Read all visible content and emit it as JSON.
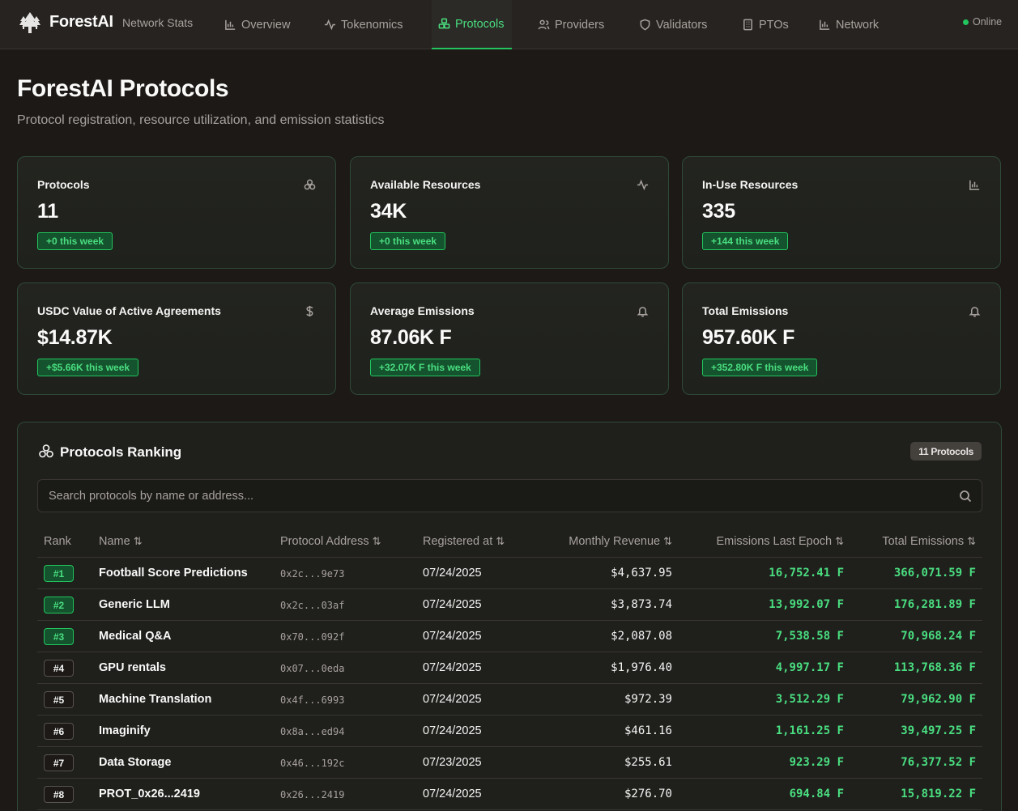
{
  "header": {
    "brand": "ForestAI",
    "brand_sub": "Network Stats",
    "nav": [
      {
        "label": "Overview",
        "icon": "bar-chart-icon"
      },
      {
        "label": "Tokenomics",
        "icon": "activity-icon"
      },
      {
        "label": "Protocols",
        "icon": "boxes-icon",
        "active": true
      },
      {
        "label": "Providers",
        "icon": "users-icon"
      },
      {
        "label": "Validators",
        "icon": "shield-icon"
      },
      {
        "label": "PTOs",
        "icon": "building-icon"
      },
      {
        "label": "Network",
        "icon": "bar-chart-icon"
      }
    ],
    "status": "Online",
    "status_color": "#22c55e"
  },
  "page": {
    "title": "ForestAI Protocols",
    "subtitle": "Protocol registration, resource utilization, and emission statistics"
  },
  "cards": [
    {
      "label": "Protocols",
      "value": "11",
      "delta": "+0 this week",
      "icon": "boxes-icon"
    },
    {
      "label": "Available Resources",
      "value": "34K",
      "delta": "+0 this week",
      "icon": "activity-icon"
    },
    {
      "label": "In-Use Resources",
      "value": "335",
      "delta": "+144 this week",
      "icon": "bar-chart-icon"
    },
    {
      "label": "USDC Value of Active Agreements",
      "value": "$14.87K",
      "delta": "+$5.66K this week",
      "icon": "dollar-icon"
    },
    {
      "label": "Average Emissions",
      "value": "87.06K F",
      "delta": "+32.07K F this week",
      "icon": "bell-icon"
    },
    {
      "label": "Total Emissions",
      "value": "957.60K F",
      "delta": "+352.80K F this week",
      "icon": "bell-icon"
    }
  ],
  "ranking": {
    "title": "Protocols Ranking",
    "badge": "11 Protocols",
    "search_placeholder": "Search protocols by name or address...",
    "columns": [
      "Rank",
      "Name",
      "Protocol Address",
      "Registered at",
      "Monthly Revenue",
      "Emissions Last Epoch",
      "Total Emissions"
    ],
    "sort_glyph": "⇅",
    "rows": [
      {
        "rank": "#1",
        "name": "Football Score Predictions",
        "address": "0x2c...9e73",
        "registered": "07/24/2025",
        "revenue": "$4,637.95",
        "emissions_last": "16,752.41 F",
        "total": "366,071.59 F"
      },
      {
        "rank": "#2",
        "name": "Generic LLM",
        "address": "0x2c...03af",
        "registered": "07/24/2025",
        "revenue": "$3,873.74",
        "emissions_last": "13,992.07 F",
        "total": "176,281.89 F"
      },
      {
        "rank": "#3",
        "name": "Medical Q&A",
        "address": "0x70...092f",
        "registered": "07/24/2025",
        "revenue": "$2,087.08",
        "emissions_last": "7,538.58 F",
        "total": "70,968.24 F"
      },
      {
        "rank": "#4",
        "name": "GPU rentals",
        "address": "0x07...0eda",
        "registered": "07/24/2025",
        "revenue": "$1,976.40",
        "emissions_last": "4,997.17 F",
        "total": "113,768.36 F"
      },
      {
        "rank": "#5",
        "name": "Machine Translation",
        "address": "0x4f...6993",
        "registered": "07/24/2025",
        "revenue": "$972.39",
        "emissions_last": "3,512.29 F",
        "total": "79,962.90 F"
      },
      {
        "rank": "#6",
        "name": "Imaginify",
        "address": "0x8a...ed94",
        "registered": "07/24/2025",
        "revenue": "$461.16",
        "emissions_last": "1,161.25 F",
        "total": "39,497.25 F"
      },
      {
        "rank": "#7",
        "name": "Data Storage",
        "address": "0x46...192c",
        "registered": "07/23/2025",
        "revenue": "$255.61",
        "emissions_last": "923.29 F",
        "total": "76,377.52 F"
      },
      {
        "rank": "#8",
        "name": "PROT_0x26...2419",
        "address": "0x26...2419",
        "registered": "07/24/2025",
        "revenue": "$276.70",
        "emissions_last": "694.84 F",
        "total": "15,819.22 F"
      }
    ]
  }
}
